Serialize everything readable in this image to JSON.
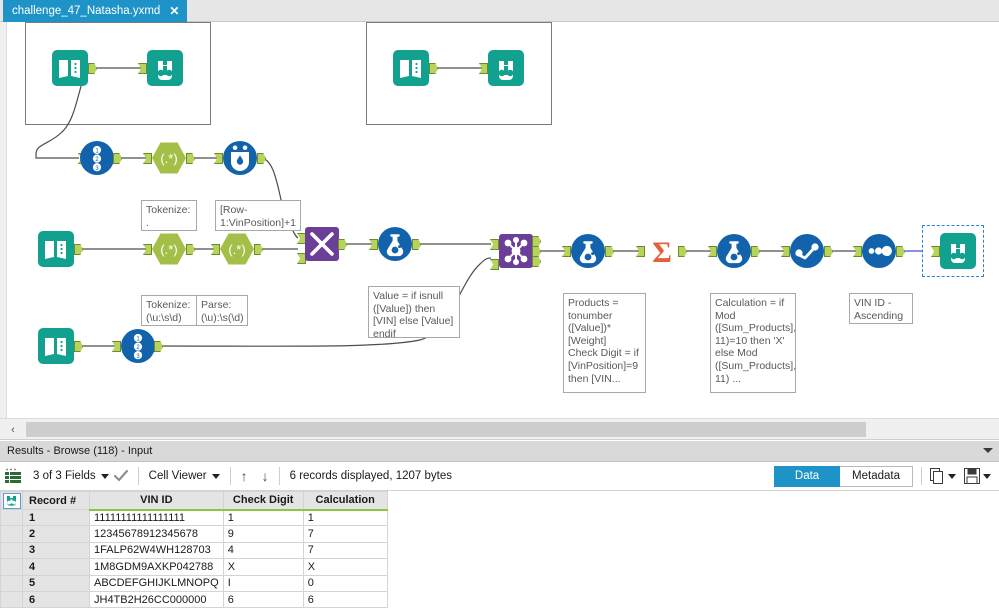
{
  "window": {
    "tab": {
      "title": "challenge_47_Natasha.yxmd",
      "close": "✕"
    }
  },
  "canvas": {
    "scrollbar": {
      "left_arrow": "‹"
    },
    "containers": [
      {
        "id": "container-1"
      },
      {
        "id": "container-2"
      }
    ],
    "tools": [
      {
        "id": "text-input-1",
        "icon": "text-input-icon",
        "type": "text-input"
      },
      {
        "id": "browse-1",
        "icon": "browse-icon",
        "type": "browse"
      },
      {
        "id": "text-input-2",
        "icon": "text-input-icon",
        "type": "text-input"
      },
      {
        "id": "browse-2",
        "icon": "browse-icon",
        "type": "browse"
      },
      {
        "id": "record-id-1",
        "icon": "record-id-icon",
        "type": "record-id"
      },
      {
        "id": "regex-1",
        "icon": "regex-icon",
        "type": "regex"
      },
      {
        "id": "multi-row-formula-1",
        "icon": "multi-row-formula-icon",
        "type": "multi-row-formula"
      },
      {
        "id": "text-input-3",
        "icon": "text-input-icon",
        "type": "text-input"
      },
      {
        "id": "regex-2",
        "icon": "regex-icon",
        "type": "regex"
      },
      {
        "id": "regex-3",
        "icon": "regex-icon",
        "type": "regex"
      },
      {
        "id": "text-input-4",
        "icon": "text-input-icon",
        "type": "text-input"
      },
      {
        "id": "record-id-2",
        "icon": "record-id-icon",
        "type": "record-id"
      },
      {
        "id": "join-multiple-1",
        "icon": "join-multiple-icon",
        "type": "join-multiple"
      },
      {
        "id": "formula-1",
        "icon": "formula-icon",
        "type": "formula"
      },
      {
        "id": "join-1",
        "icon": "join-icon",
        "type": "join"
      },
      {
        "id": "formula-2",
        "icon": "formula-icon",
        "type": "formula"
      },
      {
        "id": "summarize-1",
        "icon": "summarize-icon",
        "type": "summarize"
      },
      {
        "id": "formula-3",
        "icon": "formula-icon",
        "type": "formula"
      },
      {
        "id": "sort-1",
        "icon": "sort-icon",
        "type": "sort"
      },
      {
        "id": "select-1",
        "icon": "select-icon",
        "type": "select"
      },
      {
        "id": "browse-3",
        "icon": "browse-icon",
        "type": "browse",
        "selected": true
      }
    ],
    "annotations": [
      {
        "id": "anno-tokenize-dot",
        "text": "Tokenize:\n."
      },
      {
        "id": "anno-multirow",
        "text": "[Row-\n1:VinPosition]+1"
      },
      {
        "id": "anno-tokenize-us",
        "text": "Tokenize:\n(\\u:\\s\\d)"
      },
      {
        "id": "anno-parse",
        "text": "Parse:\n(\\u):\\s(\\d)"
      },
      {
        "id": "anno-value",
        "text": "Value = if isnull\n([Value]) then\n[VIN] else [Value]\nendif"
      },
      {
        "id": "anno-products",
        "text": "Products =\ntonumber\n([Value])*\n[Weight]\nCheck Digit = if\n[VinPosition]=9\nthen [VIN..."
      },
      {
        "id": "anno-calculation",
        "text": "Calculation = if\nMod\n([Sum_Products],\n11)=10 then 'X'\nelse Mod\n([Sum_Products],\n11) ..."
      },
      {
        "id": "anno-sort",
        "text": "VIN ID -\nAscending"
      }
    ]
  },
  "results": {
    "title": "Results - Browse (118) - Input",
    "toolbar": {
      "fields_label": "3 of 3 Fields",
      "cell_viewer_label": "Cell Viewer",
      "up_arrow": "↑",
      "down_arrow": "↓",
      "status": "6 records displayed, 1207 bytes",
      "tab_data": "Data",
      "tab_metadata": "Metadata"
    },
    "grid": {
      "columns": [
        "Record #",
        "VIN ID",
        "Check Digit",
        "Calculation"
      ],
      "rows": [
        {
          "record": "1",
          "vin_id": "11111111111111111",
          "check_digit": "1",
          "calculation": "1"
        },
        {
          "record": "2",
          "vin_id": "12345678912345678",
          "check_digit": "9",
          "calculation": "7"
        },
        {
          "record": "3",
          "vin_id": "1FALP62W4WH128703",
          "check_digit": "4",
          "calculation": "7"
        },
        {
          "record": "4",
          "vin_id": "1M8GDM9AXKP042788",
          "check_digit": "X",
          "calculation": "X"
        },
        {
          "record": "5",
          "vin_id": "ABCDEFGHIJKLMNOPQ",
          "check_digit": "I",
          "calculation": "0"
        },
        {
          "record": "6",
          "vin_id": "JH4TB2H26CC000000",
          "check_digit": "6",
          "calculation": "6"
        }
      ]
    }
  },
  "colors": {
    "accent": "#1e93c8",
    "teal": "#12a18f",
    "blue": "#1263ac",
    "green": "#a4bf48",
    "purple": "#6b3f98",
    "orange": "#e2603c"
  }
}
